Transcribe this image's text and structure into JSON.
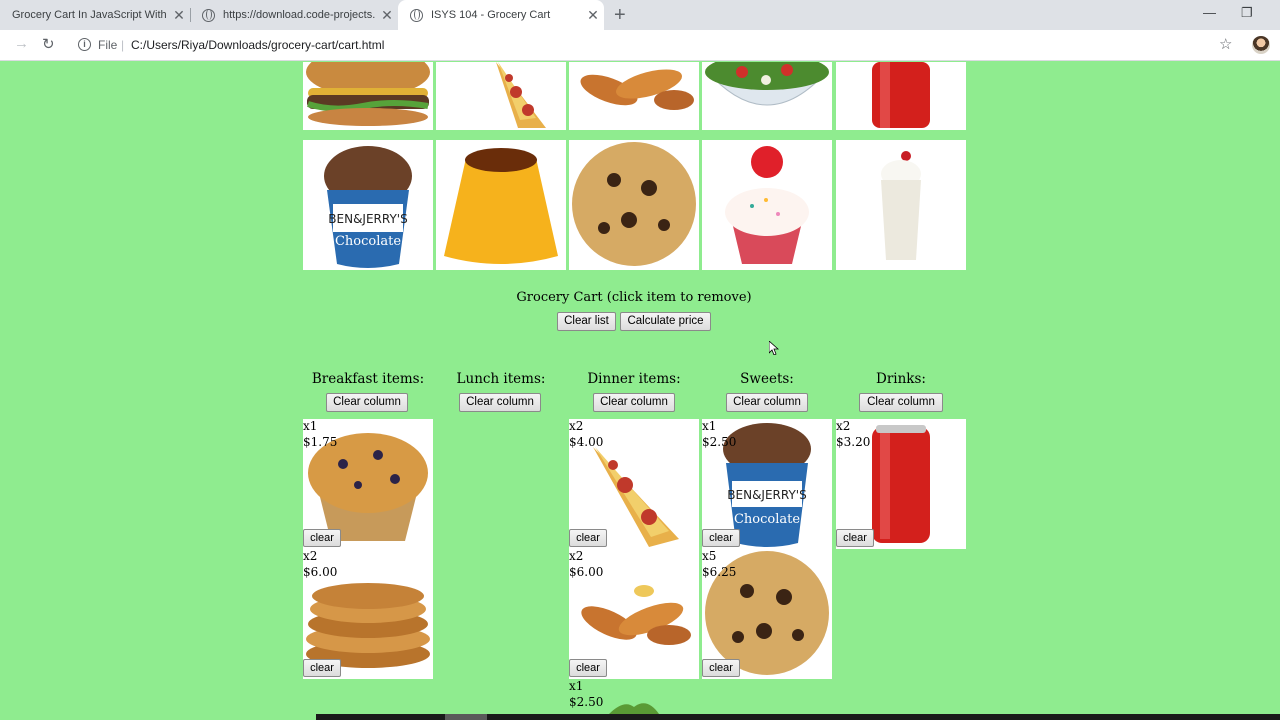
{
  "browser": {
    "tabs": [
      {
        "title": "Grocery Cart In JavaScript With S",
        "active": false
      },
      {
        "title": "https://download.code-projects.",
        "active": false
      },
      {
        "title": "ISYS 104 - Grocery Cart",
        "active": true
      }
    ],
    "new_tab_icon": "plus-icon",
    "window_controls": {
      "minimize": "—",
      "restore": "❐"
    },
    "toolbar": {
      "back_icon": "arrow-left-icon",
      "forward_icon": "arrow-right-icon",
      "reload_icon": "reload-icon",
      "file_label": "File",
      "separator": "|",
      "address": "C:/Users/Riya/Downloads/grocery-cart/cart.html",
      "bookmark_icon": "star-icon"
    }
  },
  "menu": {
    "row1": [
      "burger",
      "pizza-slice",
      "chicken-tenders",
      "salad",
      "soda-can"
    ],
    "row2": [
      "ice-cream",
      "flan",
      "cookie",
      "cupcake",
      "milkshake"
    ]
  },
  "cart": {
    "title": "Grocery Cart (click item to remove)",
    "clear_list": "Clear list",
    "calculate_price": "Calculate price",
    "clear_column": "Clear column",
    "clear": "clear",
    "columns": [
      {
        "heading": "Breakfast items:",
        "items": [
          {
            "food": "blueberry-muffin",
            "qty": "x1",
            "price": "$1.75"
          },
          {
            "food": "pancakes",
            "qty": "x2",
            "price": "$6.00"
          }
        ]
      },
      {
        "heading": "Lunch items:",
        "items": []
      },
      {
        "heading": "Dinner items:",
        "items": [
          {
            "food": "pizza-slice",
            "qty": "x2",
            "price": "$4.00"
          },
          {
            "food": "chicken-tenders",
            "qty": "x2",
            "price": "$6.00"
          },
          {
            "food": "salad",
            "qty": "x1",
            "price": "$2.50"
          }
        ]
      },
      {
        "heading": "Sweets:",
        "items": [
          {
            "food": "ice-cream",
            "qty": "x1",
            "price": "$2.50"
          },
          {
            "food": "cookie",
            "qty": "x5",
            "price": "$6.25"
          }
        ]
      },
      {
        "heading": "Drinks:",
        "items": [
          {
            "food": "soda-can",
            "qty": "x2",
            "price": "$3.20"
          }
        ]
      }
    ]
  }
}
